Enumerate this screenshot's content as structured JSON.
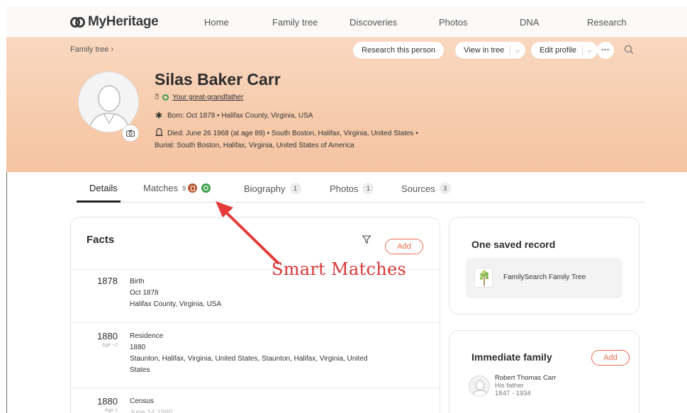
{
  "nav": {
    "logo": "MyHeritage",
    "items": [
      "Home",
      "Family tree",
      "Discoveries",
      "Photos",
      "DNA",
      "Research"
    ]
  },
  "header": {
    "breadcrumb": "Family tree",
    "research_button": "Research this person",
    "view_tree_button": "View in tree",
    "edit_profile_button": "Edit profile",
    "more_label": "···"
  },
  "person": {
    "name": "Silas Baker Carr",
    "relation": "Your great-grandfather",
    "born": "Born: Oct 1878  •  Halifax County, Virginia, USA",
    "died": "Died: June 26 1968 (at age 89)  •  South Boston, Halifax, Virginia, United States  •",
    "burial": "Burial: South Boston, Halifax, Virginia, United States of America"
  },
  "tabs": [
    {
      "label": "Details",
      "count": ""
    },
    {
      "label": "Matches",
      "count": "9"
    },
    {
      "label": "Biography",
      "count": "1"
    },
    {
      "label": "Photos",
      "count": "1"
    },
    {
      "label": "Sources",
      "count": "3"
    }
  ],
  "facts": {
    "title": "Facts",
    "add_label": "Add",
    "items": [
      {
        "year": "1878",
        "age": "",
        "type": "Birth",
        "date": "Oct 1878",
        "place": "Halifax County, Virginia, USA"
      },
      {
        "year": "1880",
        "age": "Age ~2",
        "type": "Residence",
        "date": "1880",
        "place": "Staunton, Halifax, Virginia, United States, Staunton, Halifax, Virginia, United",
        "place2": "States"
      },
      {
        "year": "1880",
        "age": "Age 1",
        "type": "Census",
        "date": "June 14 1880",
        "place": ""
      }
    ]
  },
  "saved_record": {
    "title": "One saved record",
    "item": "FamilySearch Family Tree"
  },
  "family": {
    "title": "Immediate family",
    "add_label": "Add",
    "members": [
      {
        "name": "Robert Thomas Carr",
        "relation": "His father",
        "years": "1847 - 1934"
      }
    ]
  },
  "annotation": {
    "text": "Smart Matches",
    "color": "#d93636"
  },
  "colors": {
    "hero_bg": "#f6cbab",
    "accent": "#ea6e4f",
    "smart_match_green": "#3aa14a",
    "record_match_brown": "#b8562f"
  }
}
